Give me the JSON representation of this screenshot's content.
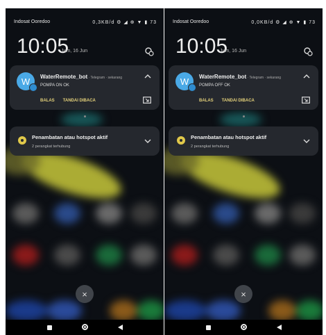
{
  "screens": [
    {
      "carrier": "Indosat Ooredoo",
      "status_right": "0,3KB/d ⚙ ◢ ⊕ ▼ ▮ 73",
      "time": "10:05",
      "date": "Jum, 16 Jun",
      "notification": {
        "avatar_letter": "W",
        "title": "WaterRemote_bot",
        "meta": " · Telegram · sekarang",
        "body": "POMPA ON OK",
        "action_reply": "BALAS",
        "action_mark_read": "TANDAI DIBACA"
      },
      "hotspot": {
        "title": "Penambatan atau hotspot aktif",
        "subtitle": "2 perangkat terhubung"
      },
      "close_label": "×"
    },
    {
      "carrier": "Indosat Ooredoo",
      "status_right": "0,0KB/d ⚙ ◢ ⊕ ▼ ▮ 73",
      "time": "10:05",
      "date": "Jum, 16 Jun",
      "notification": {
        "avatar_letter": "W",
        "title": "WaterRemote_bot",
        "meta": " · Telegram · sekarang",
        "body": "POMPA OFF OK",
        "action_reply": "BALAS",
        "action_mark_read": "TANDAI DIBACA"
      },
      "hotspot": {
        "title": "Penambatan atau hotspot aktif",
        "subtitle": "2 perangkat terhubung"
      },
      "close_label": "×"
    }
  ],
  "colors": {
    "accent_action": "#e3d07a",
    "telegram_blue": "#4aa9e6",
    "hotspot_yellow": "#e0c84a",
    "card_bg": "#262a30"
  }
}
